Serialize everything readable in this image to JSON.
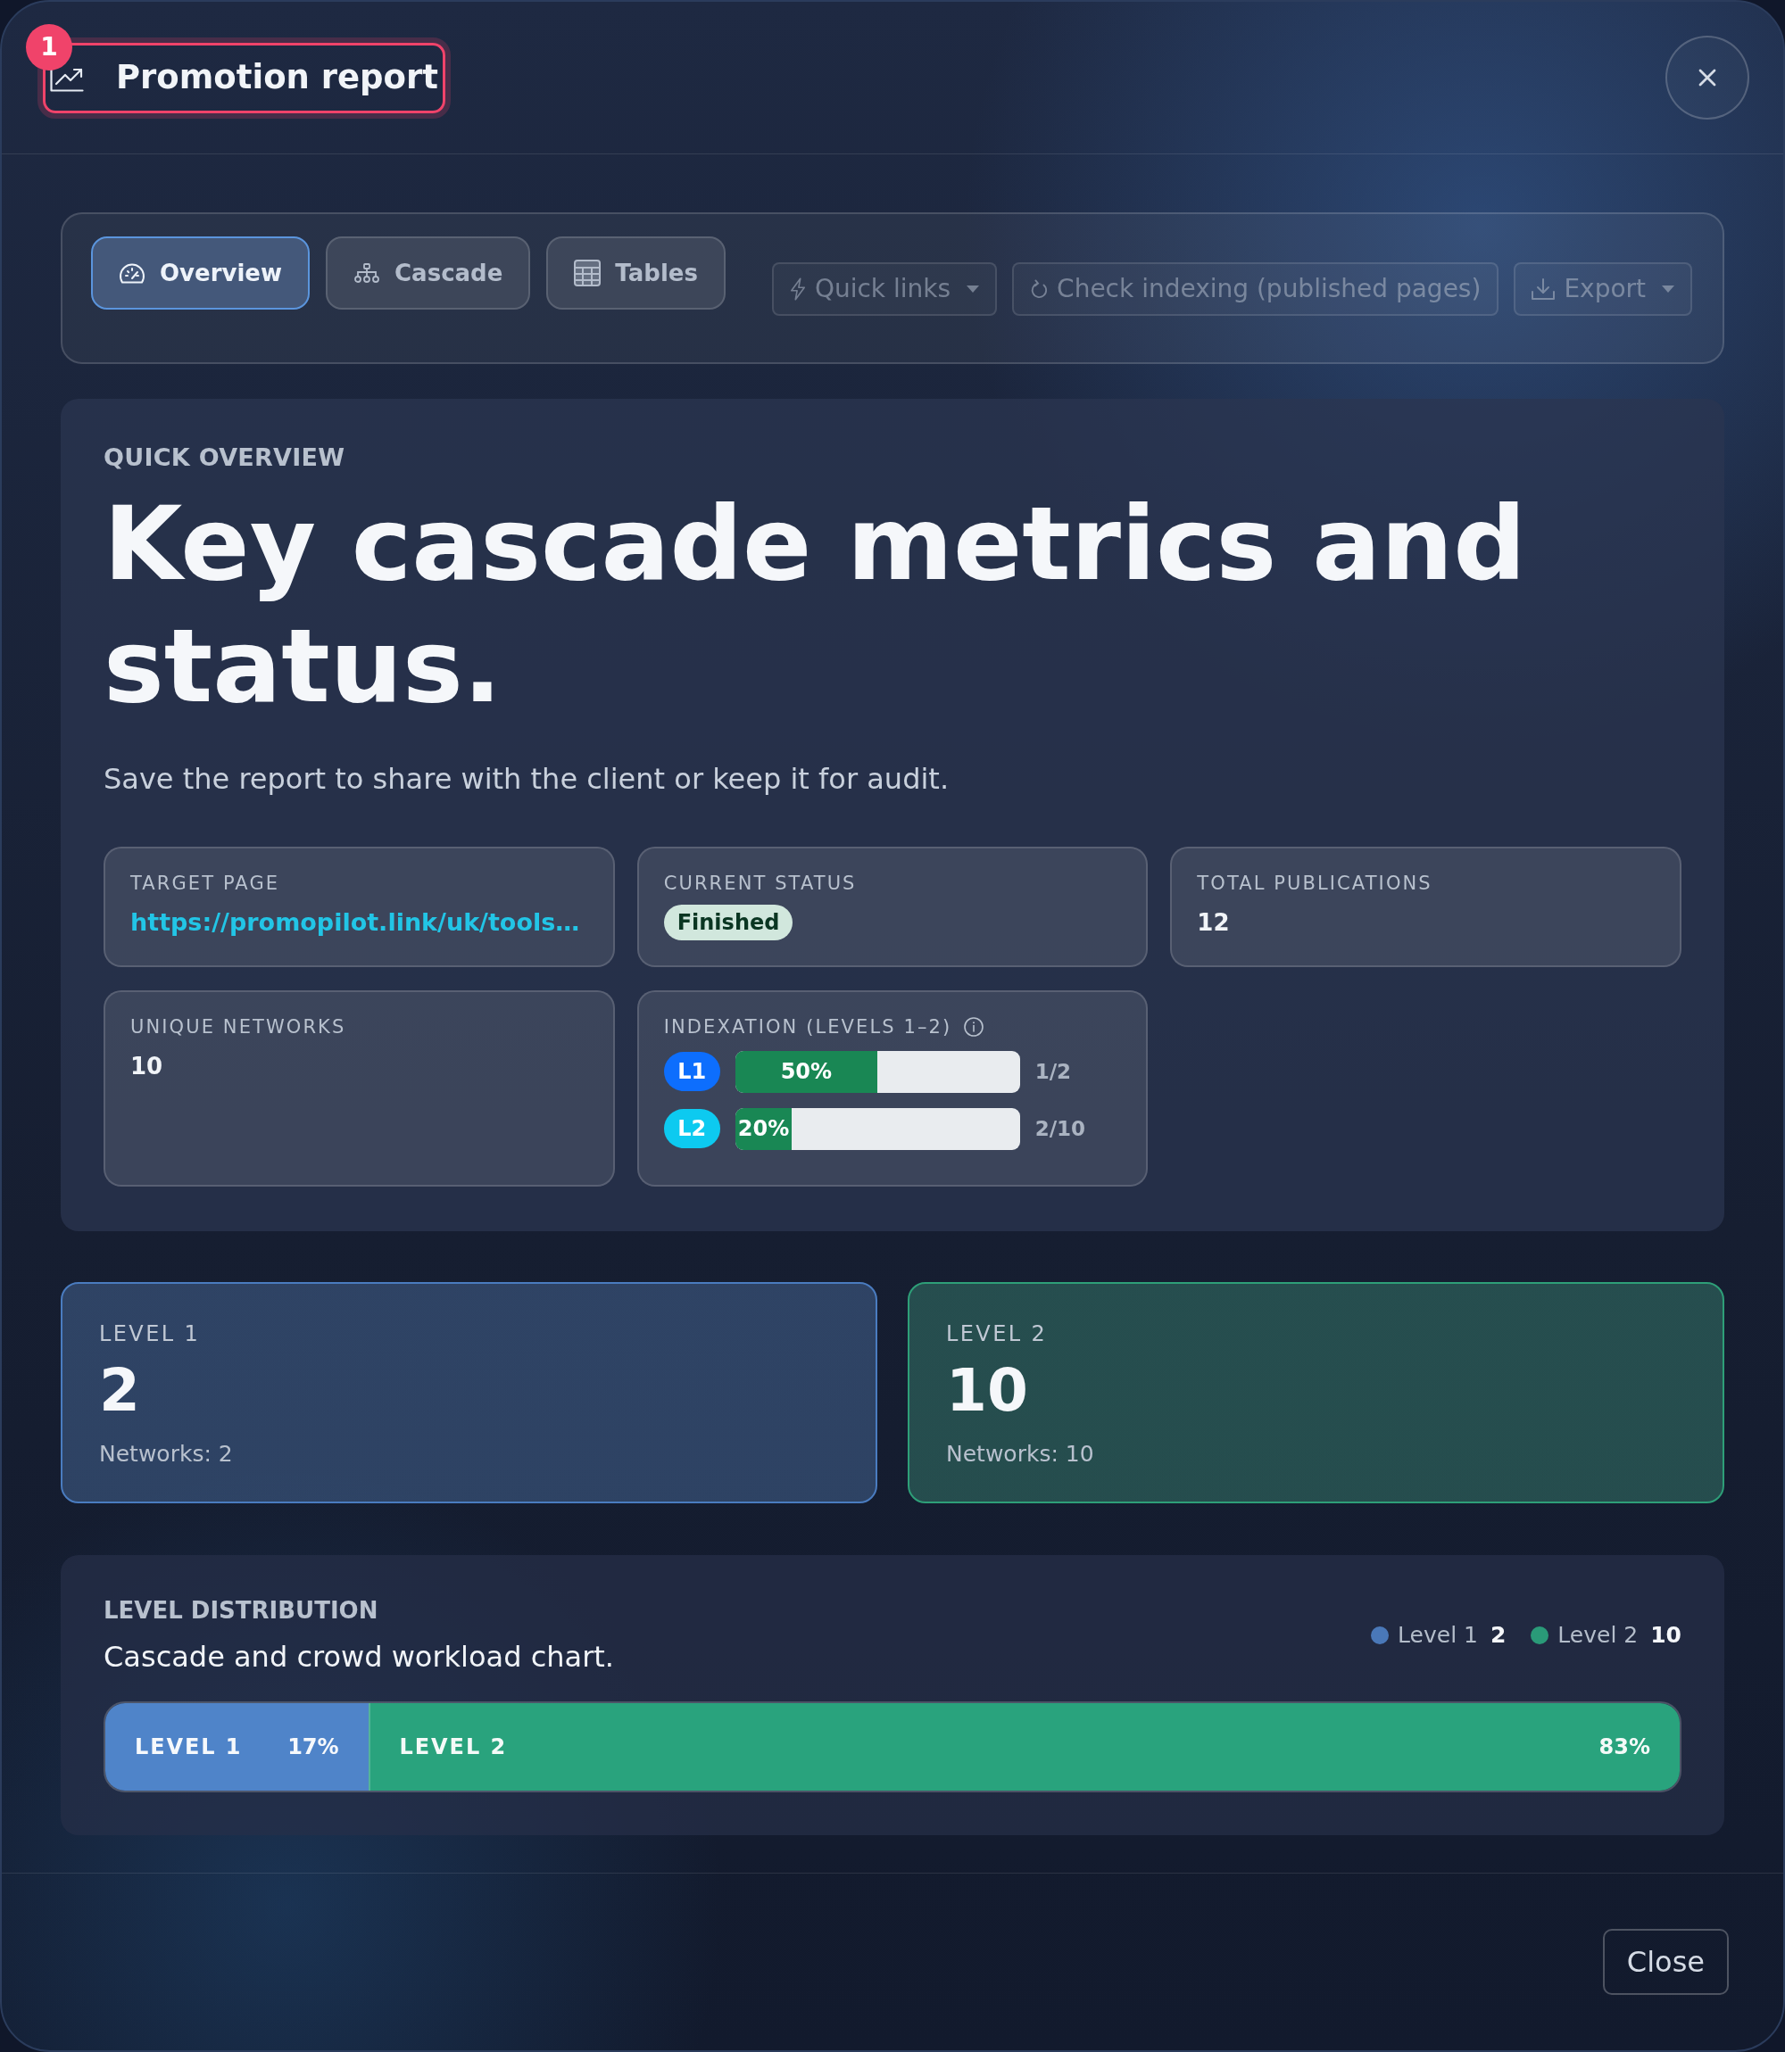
{
  "annotation": {
    "label": "1"
  },
  "window": {
    "title": "Promotion report"
  },
  "tabs": [
    {
      "label": "Overview",
      "selected": true
    },
    {
      "label": "Cascade",
      "selected": false
    },
    {
      "label": "Tables",
      "selected": false
    }
  ],
  "actions": [
    {
      "label": "Quick links",
      "dropdown": true,
      "disabled": true
    },
    {
      "label": "Check indexing (published pages)",
      "dropdown": false,
      "disabled": true
    },
    {
      "label": "Export",
      "dropdown": true,
      "disabled": true
    }
  ],
  "overview": {
    "eyebrow": "QUICK OVERVIEW",
    "heading": "Key cascade metrics and status.",
    "description": "Save the report to share with the client or keep it for audit.",
    "stats": [
      {
        "kind": "link",
        "label": "TARGET PAGE",
        "value": "https://promopilot.link/uk/tools…"
      },
      {
        "kind": "badge",
        "label": "CURRENT STATUS",
        "value": "Finished"
      },
      {
        "kind": "text",
        "label": "TOTAL PUBLICATIONS",
        "value": "12"
      },
      {
        "kind": "text",
        "label": "UNIQUE NETWORKS",
        "value": "10"
      },
      {
        "kind": "indexation",
        "label": "INDEXATION (LEVELS 1–2)",
        "rows": [
          {
            "badge": "L1",
            "color": "#0d6efd",
            "level": 0.5,
            "percent": "50%",
            "reading": "1/2"
          },
          {
            "badge": "L2",
            "color": "#0dcaf0",
            "level": 0.2,
            "percent": "20%",
            "reading": "2/10"
          }
        ]
      }
    ]
  },
  "levels": [
    {
      "label": "LEVEL 1",
      "count": "2",
      "networks": "Networks: 2",
      "color": "#4a7cc0"
    },
    {
      "label": "LEVEL 2",
      "count": "10",
      "networks": "Networks: 10",
      "color": "#2e9f78"
    }
  ],
  "distribution": {
    "title": "LEVEL DISTRIBUTION",
    "subtitle": "Cascade and crowd workload chart.",
    "legend": [
      {
        "label": "Level 1",
        "count": "2",
        "color": "#4a78b8"
      },
      {
        "label": "Level 2",
        "count": "10",
        "color": "#2a9a78"
      }
    ],
    "segments": [
      {
        "label": "LEVEL 1",
        "percent": "17%",
        "level": 0.167,
        "color": "#4f84c9"
      },
      {
        "label": "LEVEL 2",
        "percent": "83%",
        "level": 0.833,
        "color": "#29a37d"
      }
    ]
  },
  "footer": {
    "buttons": [
      "Close"
    ]
  }
}
